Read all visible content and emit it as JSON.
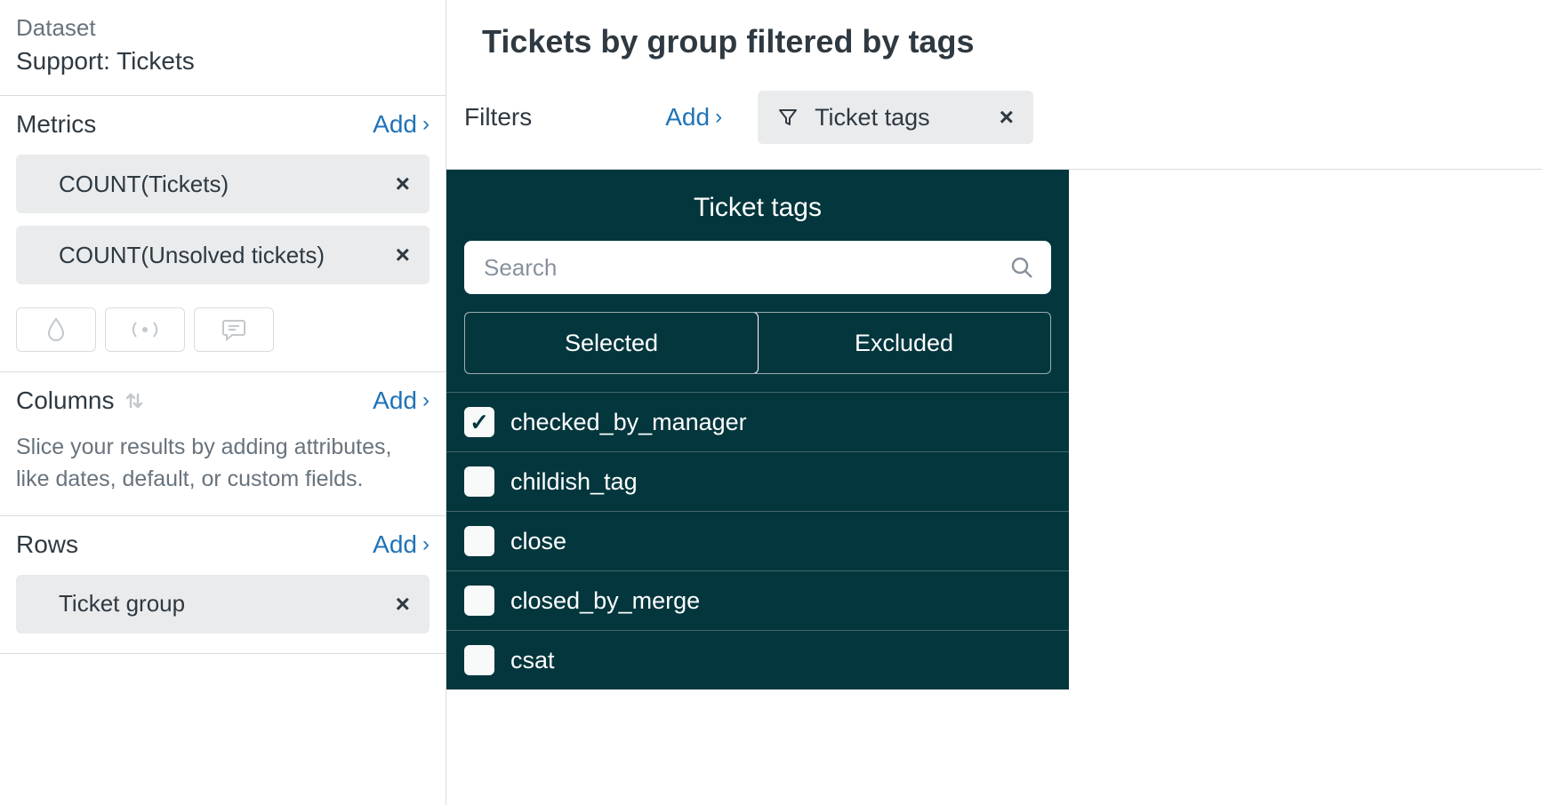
{
  "sidebar": {
    "dataset_label": "Dataset",
    "dataset_name": "Support: Tickets",
    "metrics": {
      "title": "Metrics",
      "add_label": "Add",
      "items": [
        {
          "label": "COUNT(Tickets)"
        },
        {
          "label": "COUNT(Unsolved tickets)"
        }
      ]
    },
    "columns": {
      "title": "Columns",
      "add_label": "Add",
      "helper": "Slice your results by adding attributes, like dates, default, or custom fields."
    },
    "rows": {
      "title": "Rows",
      "add_label": "Add",
      "items": [
        {
          "label": "Ticket group"
        }
      ]
    }
  },
  "main": {
    "title": "Tickets by group filtered by tags",
    "filters_label": "Filters",
    "filters_add_label": "Add",
    "filter_chip": {
      "label": "Ticket tags"
    }
  },
  "dropdown": {
    "title": "Ticket tags",
    "search_placeholder": "Search",
    "tabs": {
      "selected": "Selected",
      "excluded": "Excluded"
    },
    "options": [
      {
        "label": "checked_by_manager",
        "checked": true
      },
      {
        "label": "childish_tag",
        "checked": false
      },
      {
        "label": "close",
        "checked": false
      },
      {
        "label": "closed_by_merge",
        "checked": false
      },
      {
        "label": "csat",
        "checked": false
      }
    ]
  }
}
